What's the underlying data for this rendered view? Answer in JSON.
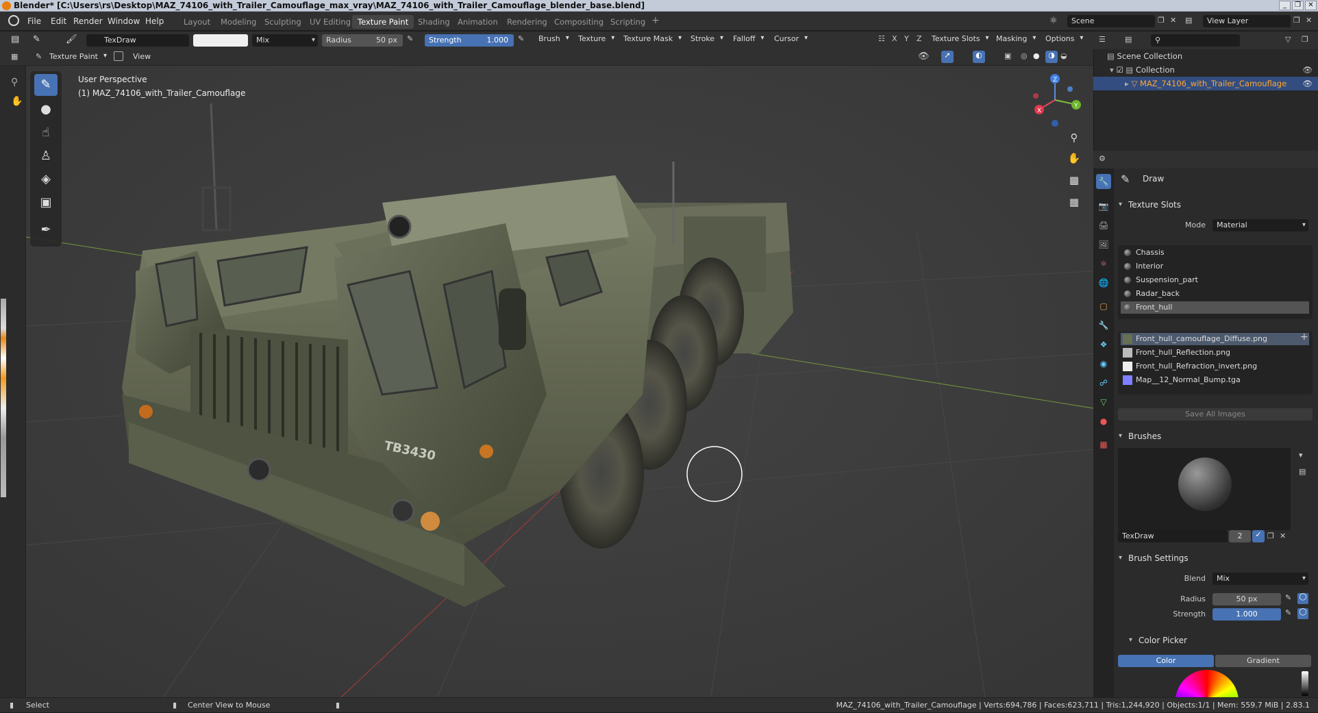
{
  "window": {
    "title": "Blender* [C:\\Users\\rs\\Desktop\\MAZ_74106_with_Trailer_Camouflage_max_vray\\MAZ_74106_with_Trailer_Camouflage_blender_base.blend]",
    "controls": [
      "_",
      "❐",
      "✕"
    ]
  },
  "menus": [
    "File",
    "Edit",
    "Render",
    "Window",
    "Help"
  ],
  "workspaces": [
    "Layout",
    "Modeling",
    "Sculpting",
    "UV Editing",
    "Texture Paint",
    "Shading",
    "Animation",
    "Rendering",
    "Compositing",
    "Scripting"
  ],
  "active_workspace": "Texture Paint",
  "scene": {
    "label": "Scene",
    "view_layer": "View Layer"
  },
  "tool_header": {
    "brush_name": "TexDraw",
    "blend": "Mix",
    "radius_label": "Radius",
    "radius_value": "50 px",
    "strength_label": "Strength",
    "strength_value": "1.000",
    "strength_fill": 1.0,
    "menus": [
      "Brush",
      "Texture",
      "Texture Mask",
      "Stroke",
      "Falloff",
      "Cursor"
    ],
    "axes": [
      "X",
      "Y",
      "Z"
    ],
    "right_menus": [
      "Texture Slots",
      "Masking",
      "Options"
    ]
  },
  "viewport_header": {
    "mode": "Texture Paint",
    "view": "View"
  },
  "viewport": {
    "perspective": "User Perspective",
    "object": "(1) MAZ_74106_with_Trailer_Camouflage",
    "plate": "TB3430",
    "gizmo": {
      "x": "X",
      "y": "Y",
      "z": "Z"
    }
  },
  "tools": [
    {
      "name": "draw-tool",
      "glyph": "✎"
    },
    {
      "name": "soften-tool",
      "glyph": "●"
    },
    {
      "name": "smear-tool",
      "glyph": "☝"
    },
    {
      "name": "clone-tool",
      "glyph": "♙"
    },
    {
      "name": "fill-tool",
      "glyph": "◈"
    },
    {
      "name": "mask-tool",
      "glyph": "▣"
    },
    {
      "name": "annotate-tool",
      "glyph": "✒"
    }
  ],
  "outliner": {
    "root": "Scene Collection",
    "collection": "Collection",
    "object": "MAZ_74106_with_Trailer_Camouflage"
  },
  "properties": {
    "active_tool": "Draw",
    "texture_slots_title": "Texture Slots",
    "mode_label": "Mode",
    "mode_value": "Material",
    "materials": [
      "Chassis",
      "Interior",
      "Suspension_part",
      "Radar_back",
      "Front_hull"
    ],
    "selected_material": "Front_hull",
    "images": [
      "Front_hull_camouflage_Diffuse.png",
      "Front_hull_Reflection.png",
      "Front_hull_Refraction_invert.png",
      "Map__12_Normal_Bump.tga"
    ],
    "selected_image": "Front_hull_camouflage_Diffuse.png",
    "save_all": "Save All Images",
    "brushes_title": "Brushes",
    "brush_name": "TexDraw",
    "brush_users": "2",
    "brush_settings_title": "Brush Settings",
    "blend_label": "Blend",
    "blend_value": "Mix",
    "radius_label": "Radius",
    "radius_value": "50 px",
    "strength_label": "Strength",
    "strength_value": "1.000",
    "color_picker_title": "Color Picker",
    "color_tab": "Color",
    "gradient_tab": "Gradient"
  },
  "statusbar": {
    "left1": "Select",
    "left2": "Center View to Mouse",
    "stats": "MAZ_74106_with_Trailer_Camouflage | Verts:694,786 | Faces:623,711 | Tris:1,244,920 | Objects:1/1 | Mem: 559.7 MiB | 2.83.1"
  },
  "colors": {
    "accent": "#4772b3",
    "header": "#303030",
    "panel": "#2b2b2b",
    "viewport": "#3d3d3d",
    "brand": "#e87d0d"
  }
}
